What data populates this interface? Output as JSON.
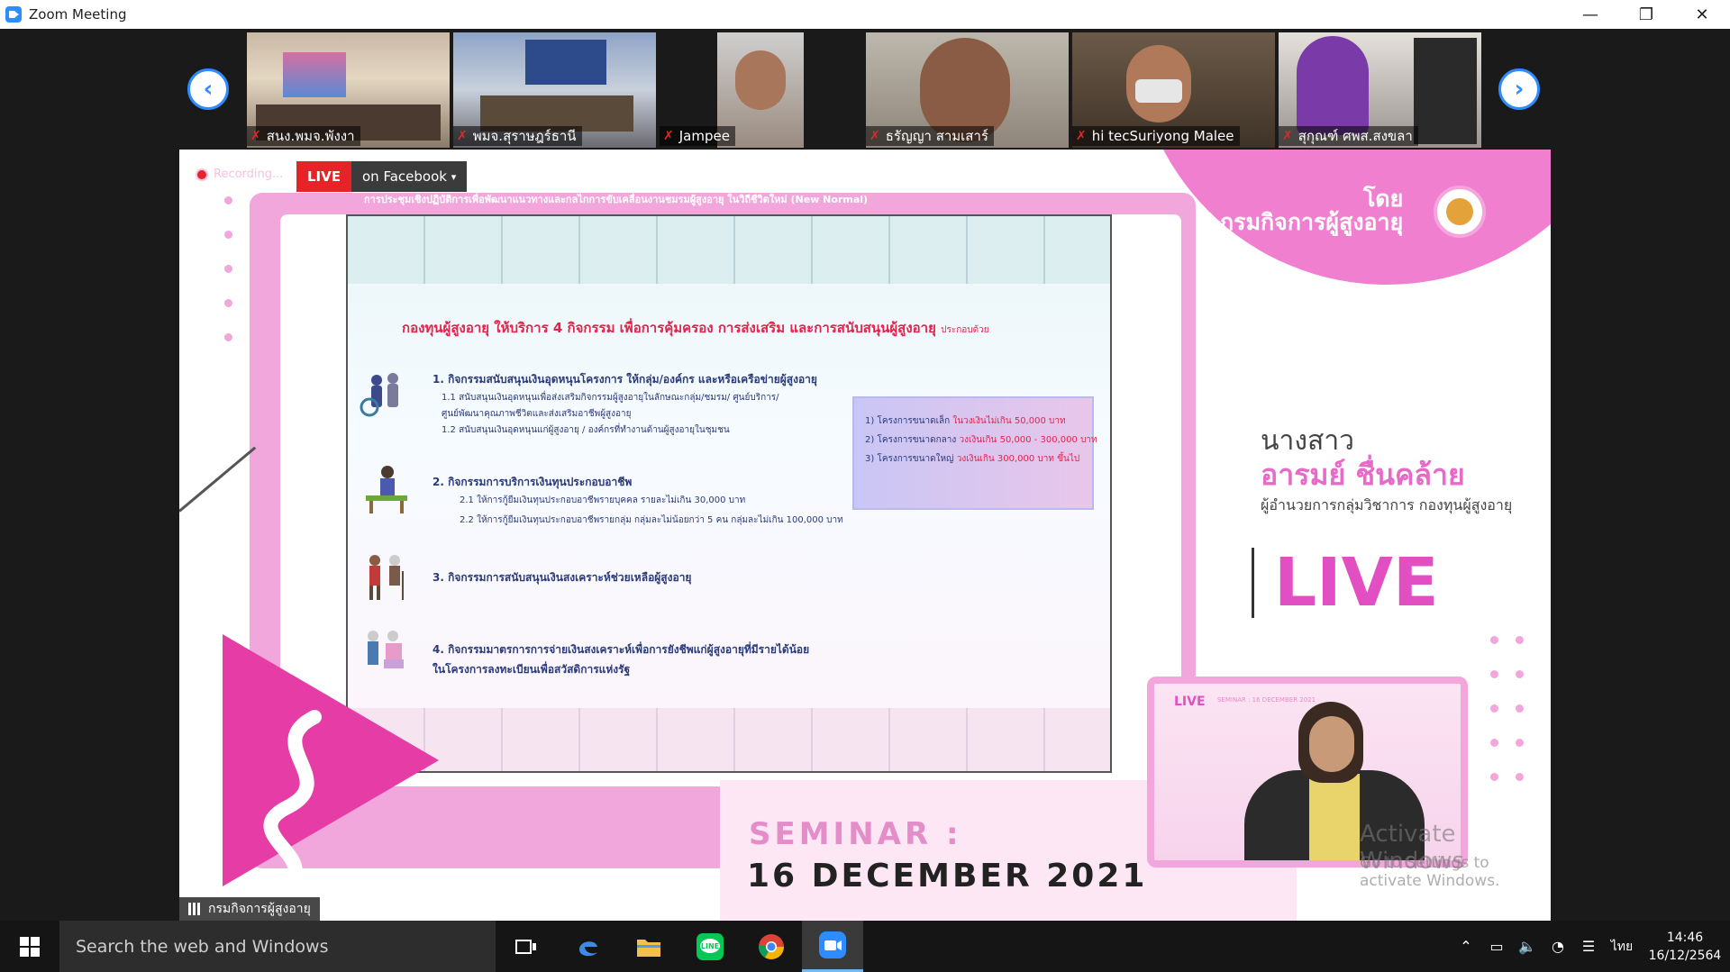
{
  "window": {
    "title": "Zoom Meeting",
    "minimize": "—",
    "restore": "❐",
    "close": "✕"
  },
  "strip": {
    "prev": "‹",
    "next": "›",
    "participants": [
      {
        "name": "สนง.พมจ.พังงา",
        "muted_icon": "✗"
      },
      {
        "name": "พมจ.สุราษฎร์ธานี",
        "muted_icon": "✗"
      },
      {
        "name": "Jampee",
        "muted_icon": "✗"
      },
      {
        "name": "ธรัญญา สามเสาร์",
        "muted_icon": "✗"
      },
      {
        "name": "hi tecSuriyong  Malee",
        "muted_icon": "✗"
      },
      {
        "name": "สุกุณฑ์ ศพส.สงขลา",
        "muted_icon": "✗"
      }
    ]
  },
  "share": {
    "recording_label": "Recording...",
    "live_label": "LIVE",
    "platform_label": "on Facebook",
    "platform_caret": "▾",
    "banner": "การประชุมเชิงปฏิบัติการเพื่อพัฒนาแนวทางและกลไกการขับเคลื่อนงานชมรมผู้สูงอายุ ในวิถีชีวิตใหม่ (New Normal)",
    "by_line1": "โดย",
    "by_line2": "กรมกิจการผู้สูงอายุ",
    "slide": {
      "title": "กองทุนผู้สูงอายุ ให้บริการ 4 กิจกรรม เพื่อการคุ้มครอง การส่งเสริม และการสนับสนุนผู้สูงอายุ",
      "title_suffix": "ประกอบด้วย",
      "item1": "1. กิจกรรมสนับสนุนเงินอุดหนุนโครงการ ให้กลุ่ม/องค์กร และหรือเครือข่ายผู้สูงอายุ",
      "item1_sub1": "1.1 สนับสนุนเงินอุดหนุนเพื่อส่งเสริมกิจกรรมผู้สูงอายุในลักษณะกลุ่ม/ชมรม/ ศูนย์บริการ/",
      "item1_sub1b": "ศูนย์พัฒนาคุณภาพชีวิตและส่งเสริมอาชีพผู้สูงอายุ",
      "item1_sub2": "1.2 สนับสนุนเงินอุดหนุนแก่ผู้สูงอายุ / องค์กรที่ทำงานด้านผู้สูงอายุในชุมชน",
      "item2": "2. กิจกรรมการบริการเงินทุนประกอบอาชีพ",
      "item2_sub1": "2.1  ให้การกู้ยืมเงินทุนประกอบอาชีพรายบุคคล   รายละไม่เกิน 30,000 บาท",
      "item2_sub2": "2.2  ให้การกู้ยืมเงินทุนประกอบอาชีพรายกลุ่ม    กลุ่มละไม่น้อยกว่า 5 คน กลุ่มละไม่เกิน 100,000 บาท",
      "item3": "3. กิจกรรมการสนับสนุนเงินสงเคราะห์ช่วยเหลือผู้สูงอายุ",
      "item4": "4. กิจกรรมมาตรการการจ่ายเงินสงเคราะห์เพื่อการยังชีพแก่ผู้สูงอายุที่มีรายได้น้อย",
      "item4b": "ในโครงการลงทะเบียนเพื่อสวัสดิการแห่งรัฐ",
      "box": {
        "line1": "1) โครงการขนาดเล็ก",
        "line1_hl": "ในวงเงินไม่เกิน 50,000 บาท",
        "line2": "2) โครงการขนาดกลาง",
        "line2_hl": "วงเงินเกิน 50,000 - 300,000 บาท",
        "line3": "3) โครงการขนาดใหญ่",
        "line3_hl": "วงเงินเกิน 300,000 บาท ขึ้นไป"
      }
    },
    "speaker_title": "นางสาว",
    "speaker_name": "อารมย์ ชื่นคล้าย",
    "speaker_role": "ผู้อำนวยการกลุ่มวิชาการ กองทุนผู้สูงอายุ",
    "live_big": "LIVE",
    "seminar_label": "SEMINAR :",
    "seminar_date": "16 DECEMBER 2021",
    "pip_live": "LIVE",
    "pip_seminar": "SEMINAR : 16 DECEMBER 2021",
    "org_tag": "กรมกิจการผู้สูงอายุ",
    "watermark_title": "Activate Windows",
    "watermark_sub": "Go to Settings to activate Windows."
  },
  "taskbar": {
    "search_placeholder": "Search the web and Windows",
    "lang": "ไทย",
    "time": "14:46",
    "date": "16/12/2564"
  },
  "colors": {
    "accent": "#2d8cff",
    "brand_pink": "#e24fc3",
    "live_red": "#e82328"
  }
}
